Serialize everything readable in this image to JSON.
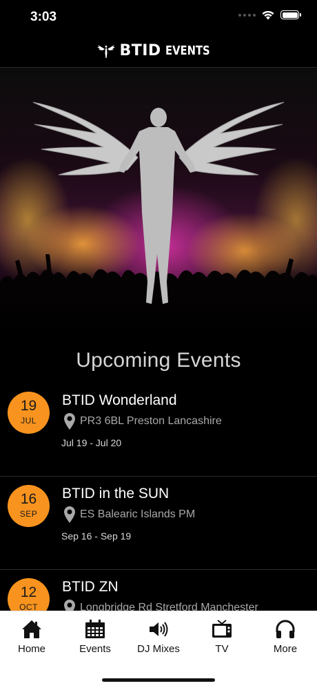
{
  "status_bar": {
    "time": "3:03"
  },
  "header": {
    "brand": "BTID",
    "brand_suffix": "EVENTS"
  },
  "section_title": "Upcoming Events",
  "events": [
    {
      "day": "19",
      "month": "JUL",
      "title": "BTID Wonderland",
      "location": "PR3 6BL Preston Lancashire",
      "dates": "Jul 19 - Jul 20"
    },
    {
      "day": "16",
      "month": "SEP",
      "title": "BTID in the SUN",
      "location": "ES Balearic Islands PM",
      "dates": "Sep 16 - Sep 19"
    },
    {
      "day": "12",
      "month": "OCT",
      "title": "BTID ZN",
      "location": "Longbridge Rd Stretford Manchester",
      "dates": ""
    }
  ],
  "tabs": [
    {
      "label": "Home",
      "icon": "home-icon"
    },
    {
      "label": "Events",
      "icon": "calendar-icon"
    },
    {
      "label": "DJ Mixes",
      "icon": "speaker-icon"
    },
    {
      "label": "TV",
      "icon": "tv-icon"
    },
    {
      "label": "More",
      "icon": "headphones-icon"
    }
  ],
  "colors": {
    "accent": "#f7931e",
    "background": "#000000",
    "tab_bar": "#ffffff"
  }
}
